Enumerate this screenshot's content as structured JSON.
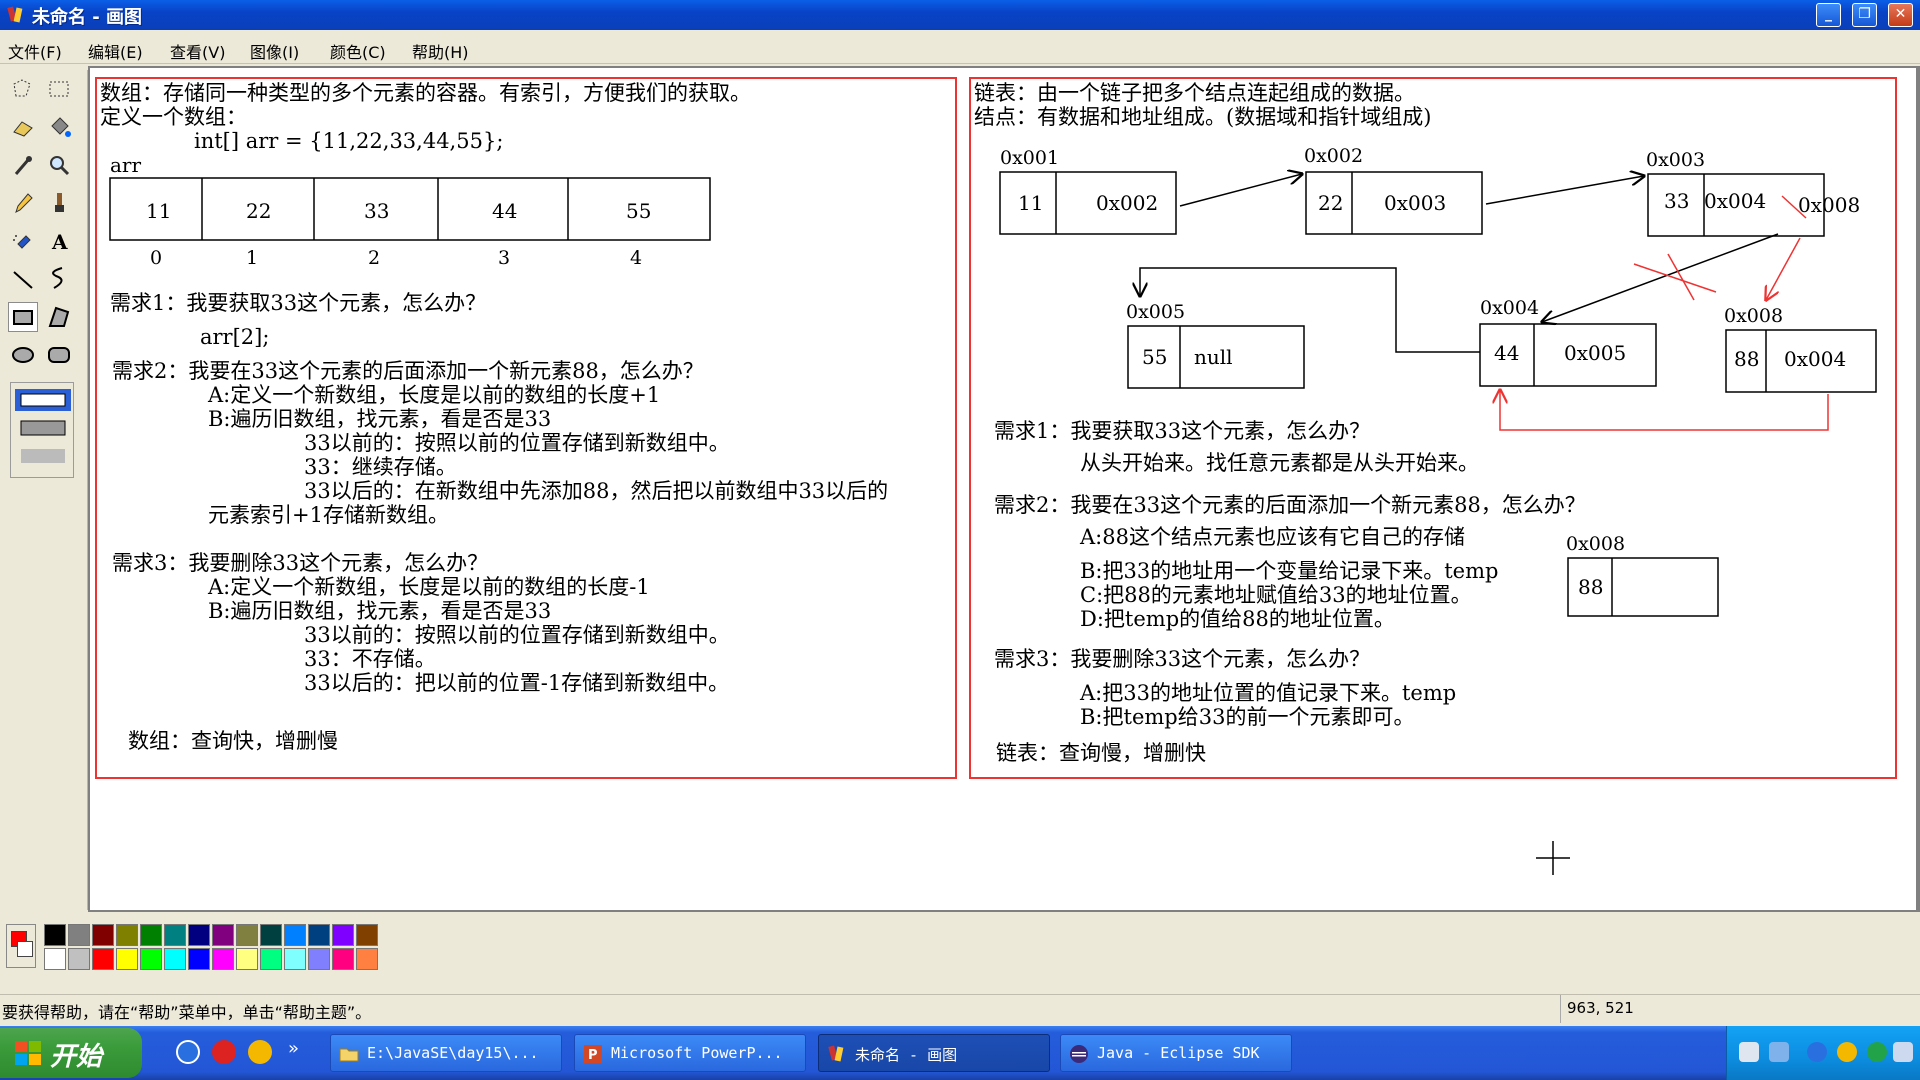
{
  "window": {
    "title": "未命名 - 画图",
    "minimize": "_",
    "maximize": "❐",
    "close": "✕"
  },
  "menu": [
    "文件(F)",
    "编辑(E)",
    "查看(V)",
    "图像(I)",
    "颜色(C)",
    "帮助(H)"
  ],
  "toolbox": [
    "free-select",
    "rect-select",
    "eraser",
    "fill",
    "color-picker",
    "magnifier",
    "pencil",
    "brush",
    "airbrush",
    "text",
    "line",
    "curve",
    "rectangle",
    "polygon",
    "ellipse",
    "rounded-rect"
  ],
  "canvas": {
    "left_panel": {
      "line1": "数组：存储同一种类型的多个元素的容器。有索引，方便我们的获取。",
      "line2": "定义一个数组：",
      "code": "int[] arr = {11,22,33,44,55};",
      "arr_label": "arr",
      "cells": [
        "11",
        "22",
        "33",
        "44",
        "55"
      ],
      "indices": [
        "0",
        "1",
        "2",
        "3",
        "4"
      ],
      "req1": "需求1：我要获取33这个元素，怎么办？",
      "req1_ans": "arr[2];",
      "req2": "需求2：我要在33这个元素的后面添加一个新元素88，怎么办？",
      "req2_a": "A:定义一个新数组，长度是以前的数组的长度+1",
      "req2_b": "B:遍历旧数组，找元素，看是否是33",
      "req2_b1": "33以前的：按照以前的位置存储到新数组中。",
      "req2_b2": "33：继续存储。",
      "req2_b3": "33以后的：在新数组中先添加88，然后把以前数组中33以后的",
      "req2_b4": "元素索引+1存储新数组。",
      "req3": "需求3：我要删除33这个元素，怎么办？",
      "req3_a": "A:定义一个新数组，长度是以前的数组的长度-1",
      "req3_b": "B:遍历旧数组，找元素，看是否是33",
      "req3_b1": "33以前的：按照以前的位置存储到新数组中。",
      "req3_b2": "33：不存储。",
      "req3_b3": "33以后的：把以前的位置-1存储到新数组中。",
      "summary": "数组：查询快，增删慢"
    },
    "right_panel": {
      "line1": "链表：由一个链子把多个结点连起组成的数据。",
      "line2": "结点：有数据和地址组成。(数据域和指针域组成)",
      "nodes": [
        {
          "addr": "0x001",
          "data": "11",
          "next": "0x002"
        },
        {
          "addr": "0x002",
          "data": "22",
          "next": "0x003"
        },
        {
          "addr": "0x003",
          "data": "33",
          "next": "0x004"
        },
        {
          "addr": "0x004",
          "data": "44",
          "next": "0x005"
        },
        {
          "addr": "0x005",
          "data": "55",
          "next": "null"
        },
        {
          "addr": "0x008",
          "data": "88",
          "next": "0x004"
        }
      ],
      "overwrite": "0x008",
      "req1": "需求1：我要获取33这个元素，怎么办？",
      "req1_ans": "从头开始来。找任意元素都是从头开始来。",
      "req2": "需求2：我要在33这个元素的后面添加一个新元素88，怎么办？",
      "req2_a": "A:88这个结点元素也应该有它自己的存储",
      "req2_b": "B:把33的地址用一个变量给记录下来。temp",
      "req2_c": "C:把88的元素地址赋值给33的地址位置。",
      "req2_d": "D:把temp的值给88的地址位置。",
      "new_node_addr": "0x008",
      "new_node_data": "88",
      "req3": "需求3：我要删除33这个元素，怎么办？",
      "req3_a": "A:把33的地址位置的值记录下来。temp",
      "req3_b": "B:把temp给33的前一个元素即可。",
      "summary": "链表：查询慢，增删快"
    }
  },
  "palette": [
    "#000000",
    "#808080",
    "#800000",
    "#808000",
    "#008000",
    "#008080",
    "#000080",
    "#800080",
    "#808040",
    "#004040",
    "#0080ff",
    "#004080",
    "#8000ff",
    "#804000",
    "#ffffff",
    "#c0c0c0",
    "#ff0000",
    "#ffff00",
    "#00ff00",
    "#00ffff",
    "#0000ff",
    "#ff00ff",
    "#ffff80",
    "#00ff80",
    "#80ffff",
    "#8080ff",
    "#ff0080",
    "#ff8040"
  ],
  "palette_fg": "#ff0000",
  "statusbar": {
    "help": "要获得帮助，请在“帮助”菜单中，单击“帮助主题”。",
    "coords": "963, 521"
  },
  "taskbar": {
    "start": "开始",
    "more": "»",
    "tasks": [
      "E:\\JavaSE\\day15\\...",
      "Microsoft PowerP...",
      "未命名 - 画图",
      "Java - Eclipse SDK"
    ]
  }
}
